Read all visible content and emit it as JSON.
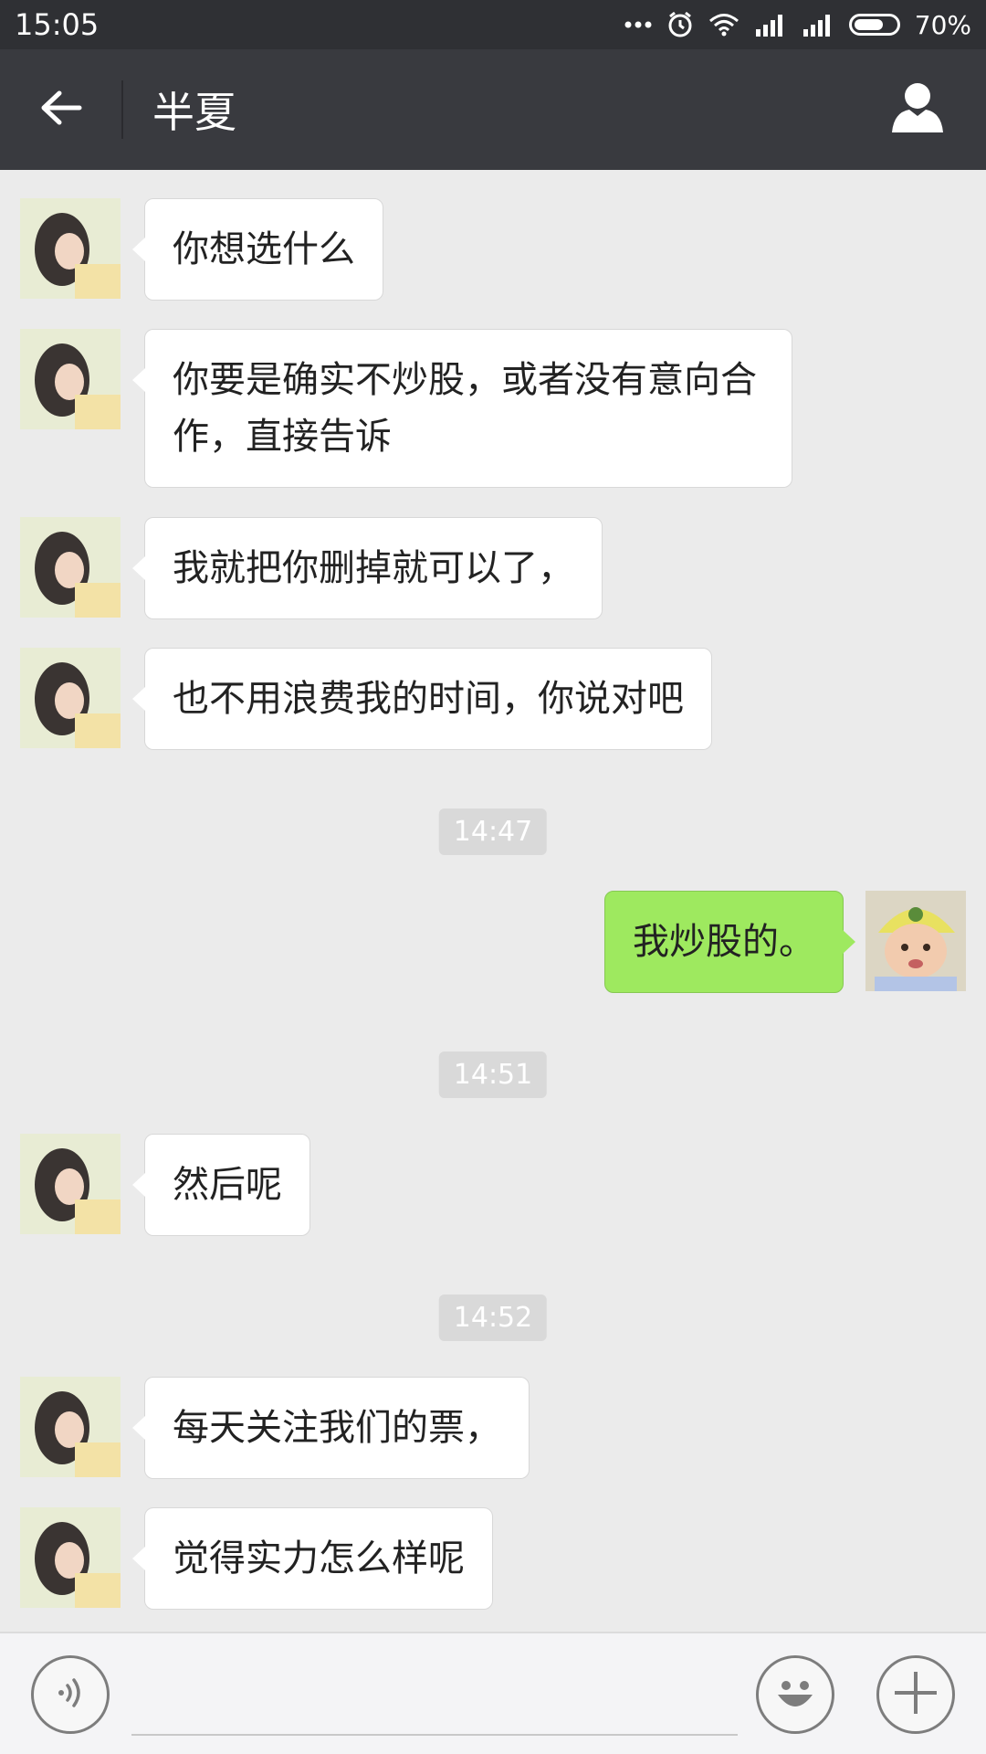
{
  "status_bar": {
    "time": "15:05",
    "battery": "70%",
    "battery_level": 0.7,
    "icons": [
      "more-dots-icon",
      "alarm-icon",
      "wifi-icon",
      "signal-icon",
      "signal-icon",
      "battery-icon"
    ]
  },
  "header": {
    "title": "半夏",
    "back_icon": "arrow-left-icon",
    "profile_icon": "person-icon"
  },
  "messages": [
    {
      "side": "left",
      "text": "你想选什么"
    },
    {
      "side": "left",
      "text": "你要是确实不炒股，或者没有意向合作，直接告诉"
    },
    {
      "side": "left",
      "text": "我就把你删掉就可以了，"
    },
    {
      "side": "left",
      "text": "也不用浪费我的时间，你说对吧"
    },
    {
      "type": "time",
      "text": "14:47"
    },
    {
      "side": "right",
      "text": "我炒股的。"
    },
    {
      "type": "time",
      "text": "14:51"
    },
    {
      "side": "left",
      "text": "然后呢"
    },
    {
      "type": "time",
      "text": "14:52"
    },
    {
      "side": "left",
      "text": "每天关注我们的票，"
    },
    {
      "side": "left",
      "text": "觉得实力怎么样呢"
    }
  ],
  "input_bar": {
    "voice_icon": "voice-icon",
    "emoji_icon": "emoji-icon",
    "plus_icon": "plus-icon",
    "placeholder": ""
  },
  "colors": {
    "status_bar": "#2f3034",
    "title_bar": "#393a3f",
    "chat_background": "#ebebeb",
    "sent_bubble": "#9ee95f",
    "received_bubble": "#ffffff"
  }
}
